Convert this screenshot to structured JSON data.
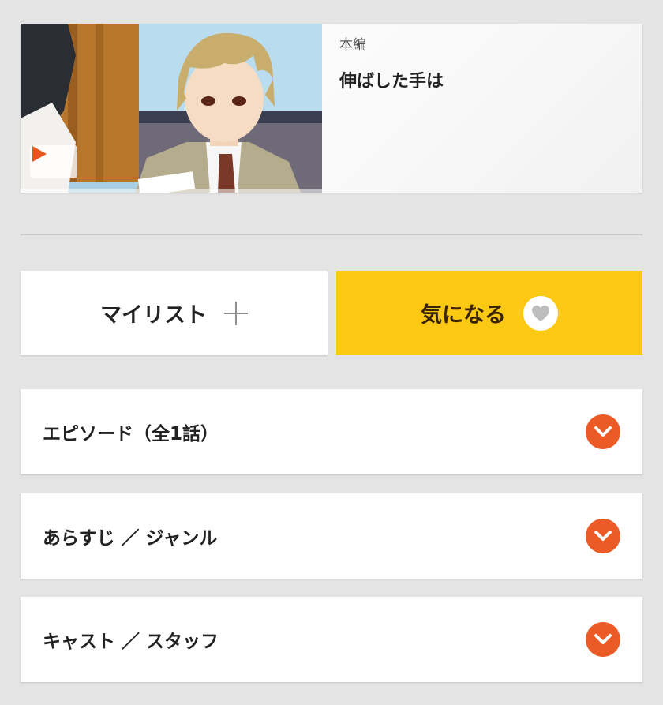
{
  "episode": {
    "type_label": "本編",
    "title": "伸ばした手は"
  },
  "actions": {
    "mylist_label": "マイリスト",
    "favorite_label": "気になる"
  },
  "sections": [
    {
      "label": "エピソード（全1話）"
    },
    {
      "label": "あらすじ ／ ジャンル"
    },
    {
      "label": "キャスト ／ スタッフ"
    }
  ],
  "colors": {
    "background": "#e4e4e4",
    "favorite_accent": "#fbc813",
    "chevron_accent": "#ec5b26",
    "play_accent": "#e8561f"
  },
  "icons": {
    "play": "play-icon",
    "plus": "plus-icon",
    "heart": "heart-icon",
    "chevron": "chevron-down-icon"
  }
}
